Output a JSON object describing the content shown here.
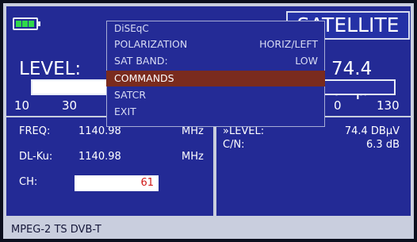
{
  "header": {
    "mode_label": "SATELLITE",
    "battery": {
      "icon": "battery-icon",
      "level": 0.75,
      "color": "#2fd84a"
    }
  },
  "level_meter": {
    "label": "LEVEL:",
    "value_text": "74.4 dBµV",
    "scale_min": 10,
    "scale_max": 130,
    "visible_ticks": [
      "10",
      "30",
      "0",
      "130"
    ],
    "reading": 74.4
  },
  "left_panel": {
    "freq": {
      "label": "FREQ:",
      "value": "1140.98",
      "unit": "MHz"
    },
    "dl": {
      "label": "DL-Ku:",
      "value": "1140.98",
      "unit": "MHz"
    },
    "channel": {
      "label": "CH:",
      "value": "61"
    }
  },
  "right_panel": {
    "level": {
      "label": "»LEVEL:",
      "value": "74.4 DBµV"
    },
    "cn": {
      "label": "C/N:",
      "value": "6.3 dB"
    }
  },
  "status_bar": {
    "text": "MPEG-2 TS DVB-T"
  },
  "menu": {
    "title": "DiSEqC",
    "items": [
      {
        "label": "POLARIZATION",
        "value": "HORIZ/LEFT"
      },
      {
        "label": "SAT BAND:",
        "value": "LOW"
      },
      {
        "label": "COMMANDS",
        "value": ""
      },
      {
        "label": "SATCR",
        "value": ""
      },
      {
        "label": "EXIT",
        "value": ""
      }
    ],
    "selected_index": 2
  },
  "colors": {
    "panel_blue": "#232a95",
    "selection": "#7a2b1e",
    "background": "#c9cede",
    "channel_text": "#d01818"
  }
}
